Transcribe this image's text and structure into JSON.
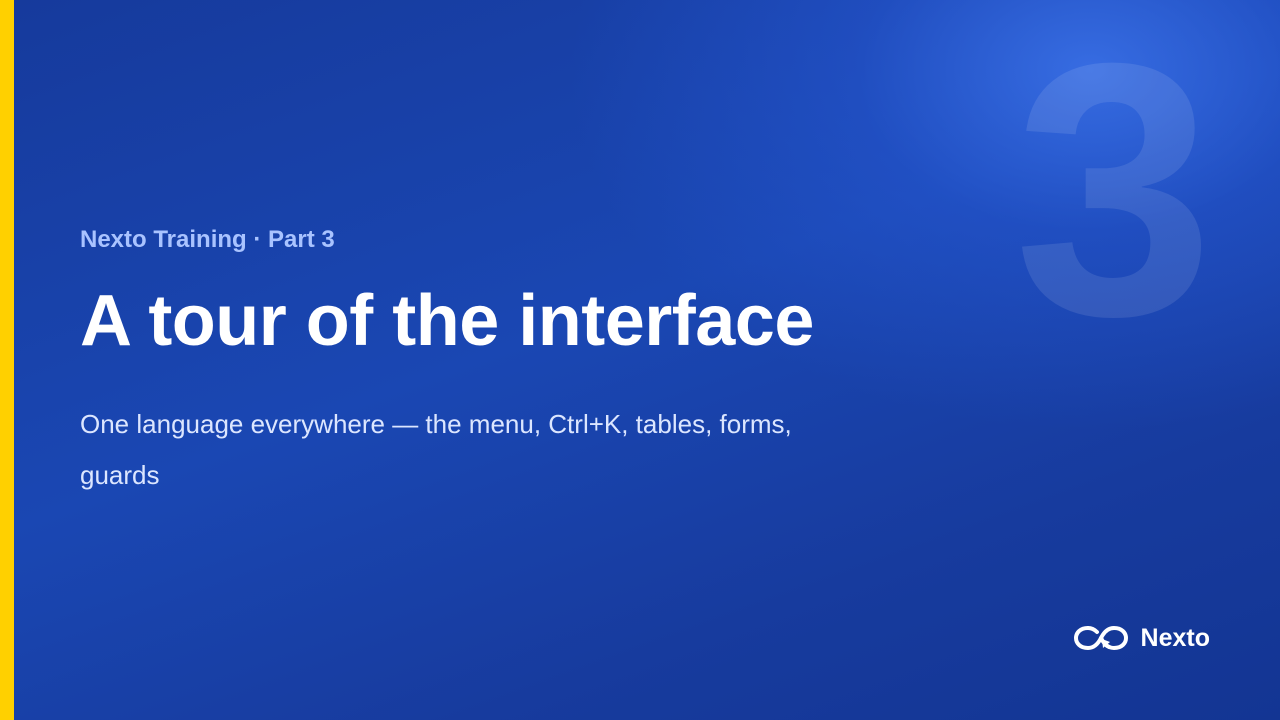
{
  "slide": {
    "number": "3",
    "kicker": "Nexto Training · Part 3",
    "title": "A tour of the interface",
    "subtitle": "One language everywhere — the menu, Ctrl+K, tables, forms, guards"
  },
  "brand": {
    "name": "Nexto",
    "logo_icon": "infinity-arrow-icon"
  },
  "colors": {
    "accent": "#ffd000",
    "background": "#1a47b3",
    "kicker": "#a9c3ff"
  }
}
